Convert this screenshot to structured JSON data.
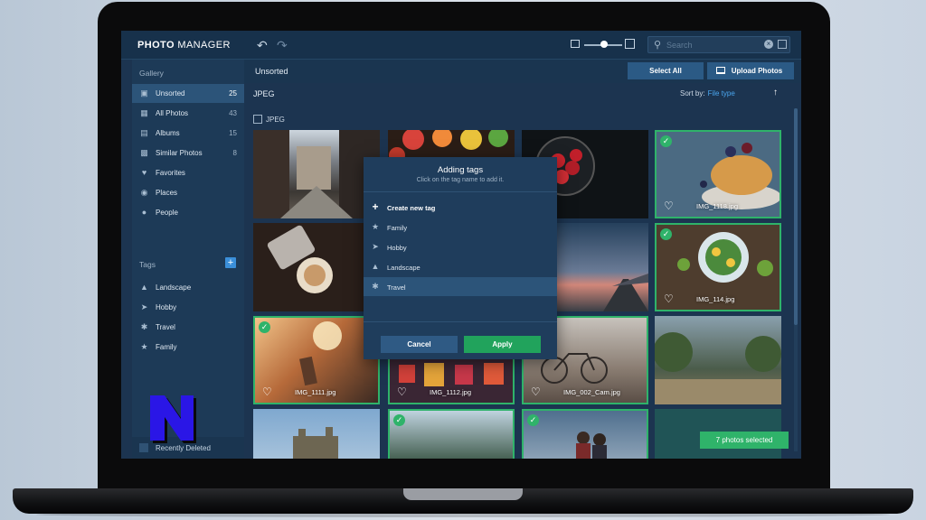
{
  "app": {
    "brand_bold": "PHOTO",
    "brand_rest": " MANAGER",
    "search_placeholder": "Search"
  },
  "sidebar": {
    "heading": "Gallery",
    "items": [
      {
        "label": "Unsorted",
        "count": "25",
        "icon": "inbox-icon"
      },
      {
        "label": "All Photos",
        "count": "43",
        "icon": "photos-icon"
      },
      {
        "label": "Albums",
        "count": "15",
        "icon": "albums-icon"
      },
      {
        "label": "Similar Photos",
        "count": "8",
        "icon": "similar-icon"
      },
      {
        "label": "Favorites",
        "count": "",
        "icon": "heart-icon"
      },
      {
        "label": "Places",
        "count": "",
        "icon": "pin-icon"
      },
      {
        "label": "People",
        "count": "",
        "icon": "person-icon"
      }
    ],
    "tags_heading": "Tags",
    "tags": [
      {
        "label": "Landscape",
        "icon": "landscape-icon"
      },
      {
        "label": "Hobby",
        "icon": "plane-icon"
      },
      {
        "label": "Travel",
        "icon": "palm-icon"
      },
      {
        "label": "Family",
        "icon": "family-icon"
      }
    ],
    "recent_label": "Recently Deleted"
  },
  "content": {
    "title": "Unsorted",
    "select_all": "Select All",
    "upload": "Upload Photos",
    "section": "JPEG",
    "sort_label": "Sort by:",
    "sort_value": "File type",
    "group_label": "JPEG",
    "selected_toast": "7 photos selected",
    "tiles": [
      {
        "name": "",
        "selected": false
      },
      {
        "name": "",
        "selected": false
      },
      {
        "name": "",
        "selected": false
      },
      {
        "name": "IMG_1118.jpg",
        "selected": true
      },
      {
        "name": "",
        "selected": false
      },
      {
        "name": "",
        "selected": false
      },
      {
        "name": "",
        "selected": false
      },
      {
        "name": "IMG_114.jpg",
        "selected": true
      },
      {
        "name": "IMG_1111.jpg",
        "selected": true
      },
      {
        "name": "IMG_1112.jpg",
        "selected": true
      },
      {
        "name": "IMG_002_Cam.jpg",
        "selected": true
      },
      {
        "name": "",
        "selected": false
      },
      {
        "name": "",
        "selected": false
      },
      {
        "name": "",
        "selected": true
      },
      {
        "name": "",
        "selected": true
      },
      {
        "name": "",
        "selected": false
      }
    ]
  },
  "dialog": {
    "title": "Adding tags",
    "subtitle": "Click on the tag name to add it.",
    "create": "Create new tag",
    "items": [
      "Family",
      "Hobby",
      "Landscape",
      "Travel"
    ],
    "highlighted": "Travel",
    "cancel": "Cancel",
    "apply": "Apply"
  },
  "colors": {
    "accent_green": "#2fb36a",
    "accent_blue": "#3b8fd9",
    "panel": "#1c3450",
    "link": "#4aa6ef"
  }
}
